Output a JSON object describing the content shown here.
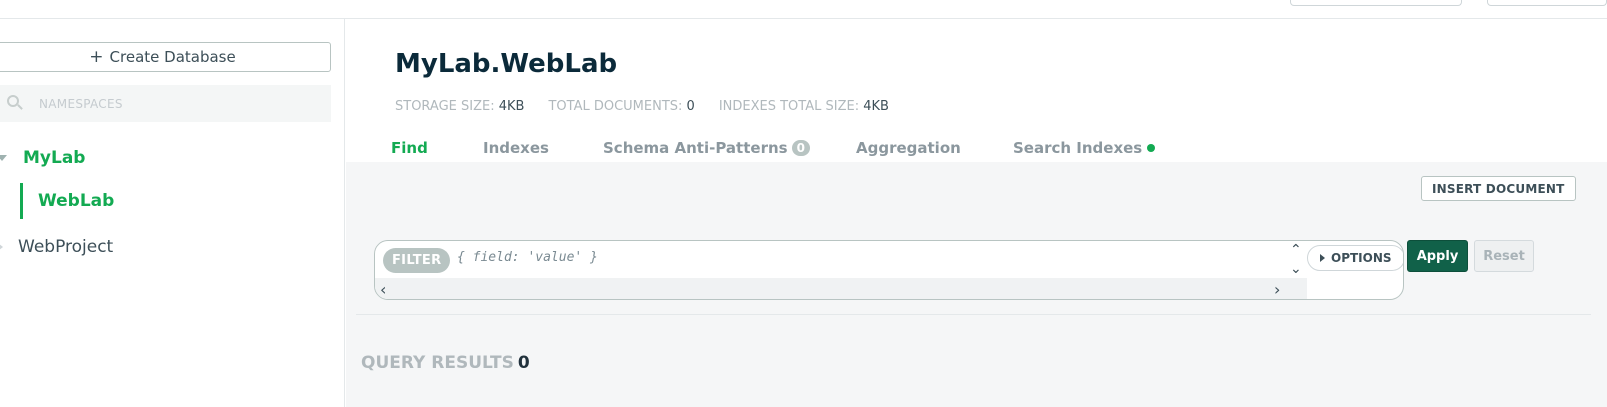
{
  "sidebar": {
    "create_database_label": "Create Database",
    "search": {
      "placeholder": "NAMESPACES",
      "value": ""
    },
    "databases": [
      {
        "name": "MyLab",
        "expanded": true,
        "collections": [
          "WebLab"
        ]
      },
      {
        "name": "WebProject",
        "expanded": false,
        "collections": []
      }
    ],
    "active_collection": "WebLab"
  },
  "collection": {
    "title": "MyLab.WebLab",
    "stats": [
      {
        "label": "STORAGE SIZE:",
        "value": "4KB"
      },
      {
        "label": "TOTAL DOCUMENTS:",
        "value": "0"
      },
      {
        "label": "INDEXES TOTAL SIZE:",
        "value": "4KB"
      }
    ]
  },
  "tabs": [
    {
      "label": "Find",
      "active": true
    },
    {
      "label": "Indexes",
      "active": false
    },
    {
      "label": "Schema Anti-Patterns",
      "badge": "0",
      "active": false
    },
    {
      "label": "Aggregation",
      "active": false
    },
    {
      "label": "Search Indexes",
      "indicator": "green-dot",
      "active": false
    }
  ],
  "toolbar": {
    "insert_document_label": "INSERT DOCUMENT"
  },
  "query": {
    "filter_label": "FILTER",
    "filter_placeholder": "{ field: 'value' }",
    "filter_value": "",
    "options_label": "OPTIONS",
    "apply_label": "Apply",
    "reset_label": "Reset"
  },
  "results": {
    "label": "QUERY RESULTS",
    "count": "0"
  },
  "colors": {
    "accent_green": "#13aa52",
    "apply_dark_green": "#116149",
    "muted_text": "#b0b8bc"
  }
}
